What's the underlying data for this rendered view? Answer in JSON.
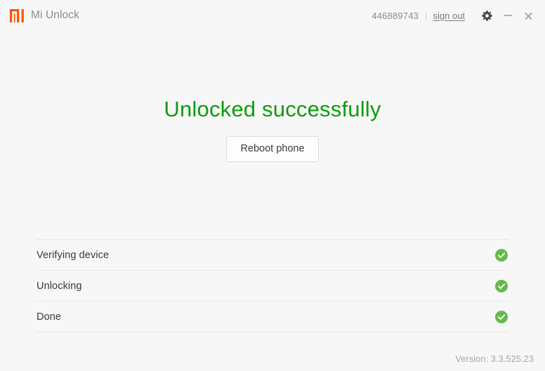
{
  "titlebar": {
    "app_title": "Mi Unlock",
    "logo_icon": "mi-logo-icon",
    "logo_color": "#ff5000",
    "account_id": "446889743",
    "separator": "|",
    "sign_out_label": "sign out",
    "settings_icon": "gear-icon",
    "minimize_icon": "minimize-icon",
    "close_icon": "close-icon"
  },
  "main": {
    "headline": "Unlocked successfully",
    "headline_color": "#0f9b0f",
    "reboot_button_label": "Reboot phone",
    "steps": [
      {
        "label": "Verifying device",
        "status": "complete",
        "status_icon": "check-circle-icon"
      },
      {
        "label": "Unlocking",
        "status": "complete",
        "status_icon": "check-circle-icon"
      },
      {
        "label": "Done",
        "status": "complete",
        "status_icon": "check-circle-icon"
      }
    ],
    "status_color": "#68b94a"
  },
  "footer": {
    "version": "Version: 3.3.525.23"
  }
}
